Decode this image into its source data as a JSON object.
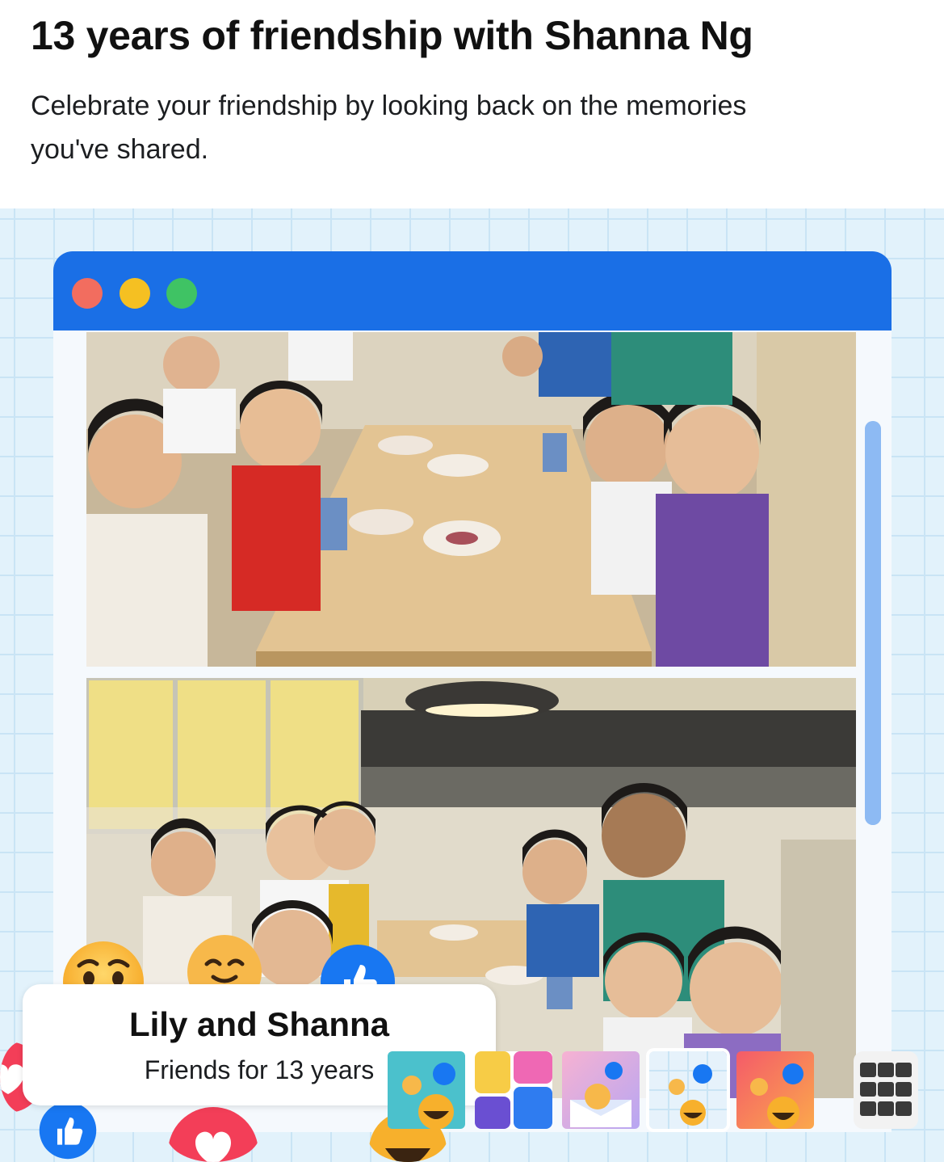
{
  "header": {
    "title": "13 years of friendship with Shanna Ng",
    "subtitle": "Celebrate your friendship by looking back on the memories you've shared."
  },
  "card": {
    "title": "Lily and Shanna",
    "subtitle": "Friends for 13 years"
  },
  "window_controls": [
    "close-dot",
    "minimize-dot",
    "maximize-dot"
  ],
  "reactions": [
    "wow-emoji-icon",
    "care-emoji-icon",
    "like-icon",
    "love-icon",
    "haha-emoji-icon"
  ],
  "themes": [
    {
      "name": "reactions-teal",
      "colors": [
        "#37b9c9",
        "#7dd6cf"
      ]
    },
    {
      "name": "color-blocks",
      "colors": [
        "#f7cc46",
        "#ef68b4",
        "#2f7cf0",
        "#6a4fd2"
      ]
    },
    {
      "name": "reactions-envelope",
      "colors": [
        "#f7b2d2",
        "#b7a6f2"
      ]
    },
    {
      "name": "reactions-grid",
      "colors": [
        "#e6f2fb",
        "#ffffff"
      ]
    },
    {
      "name": "reactions-coral",
      "colors": [
        "#f45b69",
        "#fba84c"
      ]
    }
  ],
  "colors": {
    "accent": "#1a6fe6",
    "grid_background": "#e2f2fb",
    "like_blue": "#1877f2",
    "love_red": "#f33e58"
  },
  "icons": {
    "grid": "grid-menu-icon"
  }
}
